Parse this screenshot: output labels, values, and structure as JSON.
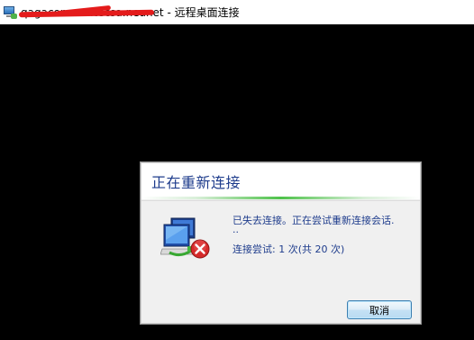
{
  "window": {
    "title_host": "qagacomencitecsa.neanet",
    "title_suffix": " - 远程桌面连接"
  },
  "dialog": {
    "title": "正在重新连接",
    "message_line1": "已失去连接。正在尝试重新连接会话.",
    "message_dots": "..",
    "attempt_text": "连接尝试: 1 次(共 20 次)",
    "cancel_label": "取消"
  },
  "colors": {
    "title_blue": "#1e3c8c",
    "progress_green": "#4ec24a",
    "error_red": "#d42a2a"
  },
  "icons": {
    "app": "remote-desktop-icon",
    "connection": "disconnected-computer-icon"
  }
}
